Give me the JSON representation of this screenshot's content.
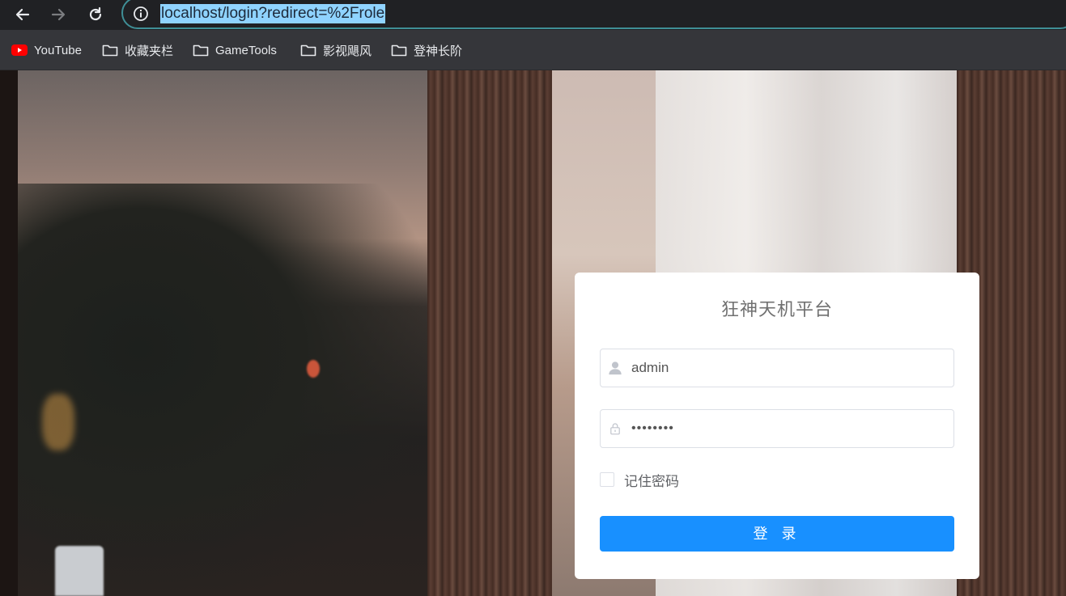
{
  "browser": {
    "url": "localhost/login?redirect=%2Frole",
    "nav": {
      "back_icon": "arrow-left-icon",
      "forward_icon": "arrow-right-icon",
      "reload_icon": "reload-icon",
      "site_info_icon": "info-circle-icon"
    },
    "bookmarks": [
      {
        "label": "YouTube",
        "icon": "youtube-icon"
      },
      {
        "label": "收藏夹栏",
        "icon": "folder-icon"
      },
      {
        "label": "GameTools",
        "icon": "folder-icon"
      },
      {
        "label": "影视飓风",
        "icon": "folder-icon"
      },
      {
        "label": "登神长阶",
        "icon": "folder-icon"
      }
    ]
  },
  "login": {
    "title": "狂神天机平台",
    "username": {
      "value": "admin",
      "icon": "user-icon"
    },
    "password": {
      "value": "••••••••",
      "icon": "lock-icon"
    },
    "remember_label": "记住密码",
    "remember_checked": false,
    "submit_label": "登 录"
  },
  "colors": {
    "primary": "#1890ff",
    "url_highlight": "#8fd3ff",
    "omnibox_border": "#3f8f96"
  }
}
